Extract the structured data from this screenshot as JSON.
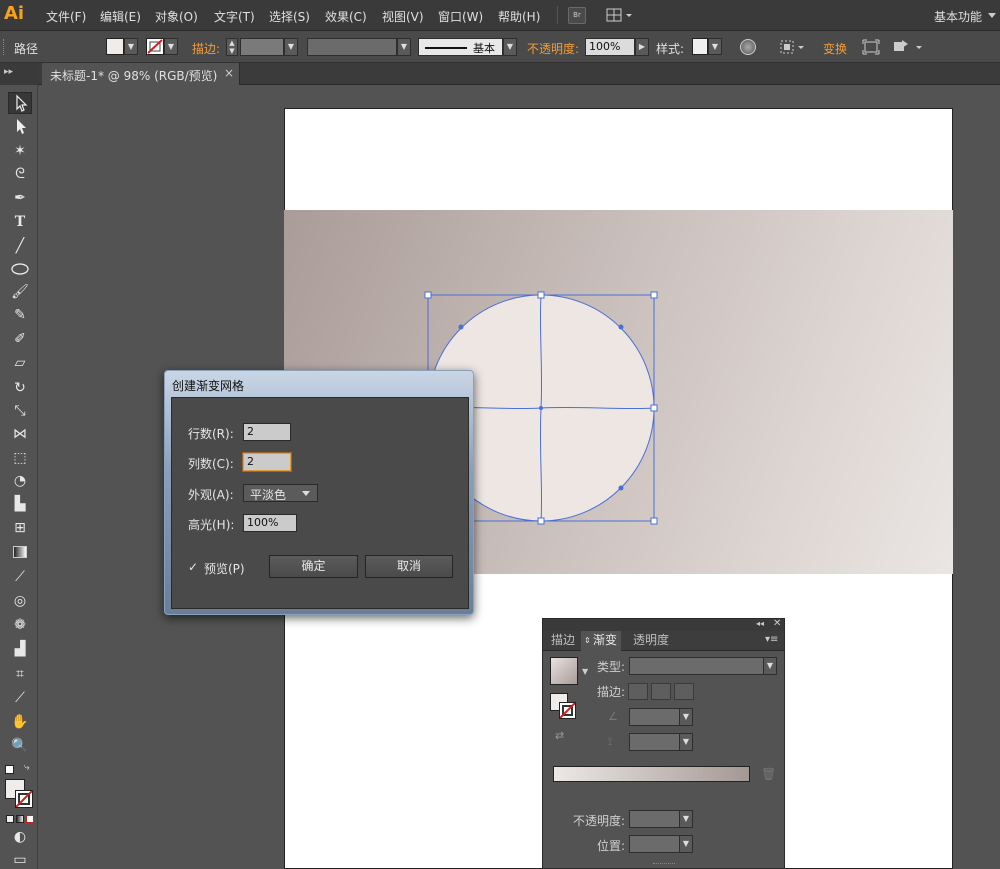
{
  "app": {
    "logo": "Ai",
    "workspace": "基本功能"
  },
  "menu": [
    "文件(F)",
    "编辑(E)",
    "对象(O)",
    "文字(T)",
    "选择(S)",
    "效果(C)",
    "视图(V)",
    "窗口(W)",
    "帮助(H)"
  ],
  "bridge_label": "Br",
  "control": {
    "path_label": "路径",
    "stroke_label": "描边:",
    "brush_label": "基本",
    "opacity_label": "不透明度:",
    "opacity_value": "100%",
    "style_label": "样式:",
    "transform_label": "变换"
  },
  "tab": {
    "title": "未标题-1* @ 98% (RGB/预览)",
    "close": "×"
  },
  "dialog": {
    "title": "创建渐变网格",
    "rows_label": "行数(R):",
    "rows_value": "2",
    "cols_label": "列数(C):",
    "cols_value": "2",
    "appearance_label": "外观(A):",
    "appearance_value": "平淡色",
    "highlight_label": "高光(H):",
    "highlight_value": "100%",
    "preview_label": "预览(P)",
    "preview_checked": true,
    "ok_label": "确定",
    "cancel_label": "取消"
  },
  "gradient_panel": {
    "tabs": [
      "描边",
      "渐变",
      "透明度"
    ],
    "active_tab": "渐变",
    "type_label": "类型:",
    "stroke_label": "描边:",
    "opacity_label": "不透明度:",
    "location_label": "位置:"
  },
  "colors": {
    "accent_orange": "#f19d38",
    "selection_blue": "#4a6fd6",
    "circle_fill": "#ede6e3",
    "gradient_start": "#aa9c98",
    "gradient_end": "#eae6e4"
  }
}
